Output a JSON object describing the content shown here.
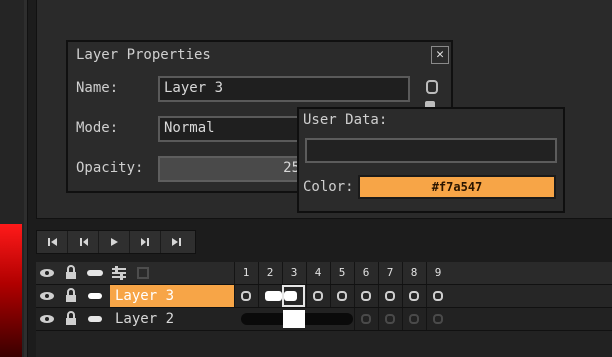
{
  "layer_properties": {
    "title": "Layer Properties",
    "close_glyph": "✕",
    "name_label": "Name:",
    "name_value": "Layer 3",
    "mode_label": "Mode:",
    "mode_value": "Normal",
    "opacity_label": "Opacity:",
    "opacity_value": "25"
  },
  "user_data_popup": {
    "user_data_label": "User Data:",
    "user_data_value": "",
    "color_label": "Color:",
    "color_value": "#f7a547"
  },
  "transport": {
    "buttons": [
      "first-frame-icon",
      "previous-frame-icon",
      "play-icon",
      "next-frame-icon",
      "last-frame-icon"
    ]
  },
  "timeline": {
    "frame_numbers": [
      "1",
      "2",
      "3",
      "4",
      "5",
      "6",
      "7",
      "8",
      "9"
    ],
    "header_icons": [
      "eye-icon",
      "lock-icon",
      "pill-icon",
      "sliders-icon",
      "checkbox-icon"
    ],
    "layers": [
      {
        "name": "Layer 3",
        "selected": true
      },
      {
        "name": "Layer 2",
        "selected": false
      }
    ]
  },
  "colors": {
    "accent": "#f7a547",
    "background": "#1c1c1c",
    "panel": "#2b2b2b"
  }
}
